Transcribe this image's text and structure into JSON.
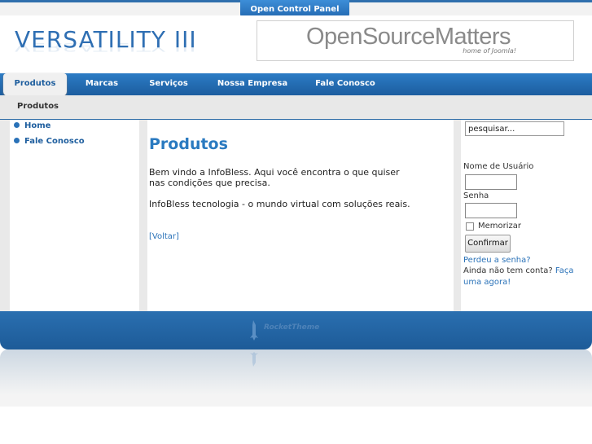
{
  "control_panel": {
    "label": "Open Control Panel"
  },
  "header": {
    "logo_text": "VERSATILITY III",
    "banner": {
      "title": "OpenSourceMatters",
      "subtitle": "home of Joomla!"
    }
  },
  "nav": {
    "items": [
      {
        "label": "Produtos",
        "active": true
      },
      {
        "label": "Marcas",
        "active": false
      },
      {
        "label": "Serviços",
        "active": false
      },
      {
        "label": "Nossa Empresa",
        "active": false
      },
      {
        "label": "Fale Conosco",
        "active": false
      }
    ]
  },
  "breadcrumb": {
    "label": "Produtos"
  },
  "sidebar": {
    "items": [
      {
        "label": "Home"
      },
      {
        "label": "Fale Conosco"
      }
    ]
  },
  "content": {
    "title": "Produtos",
    "paragraph1": "Bem vindo a InfoBless. Aqui você encontra o que quiser nas condições que precisa.",
    "paragraph2": "InfoBless tecnologia - o mundo virtual com soluções reais.",
    "back_link": "[Voltar]"
  },
  "login": {
    "search_placeholder": "pesquisar...",
    "username_label": "Nome de Usuário",
    "password_label": "Senha",
    "remember_label": "Memorizar",
    "submit_label": "Confirmar",
    "forgot_password": "Perdeu a senha?",
    "no_account": "Ainda não tem conta?",
    "register_link": "Faça uma agora!"
  },
  "footer": {
    "brand": "RocketTheme"
  },
  "colors": {
    "accent": "#2a72b8",
    "nav_bg": "#1c5d9f",
    "title": "#2a7ac0"
  }
}
